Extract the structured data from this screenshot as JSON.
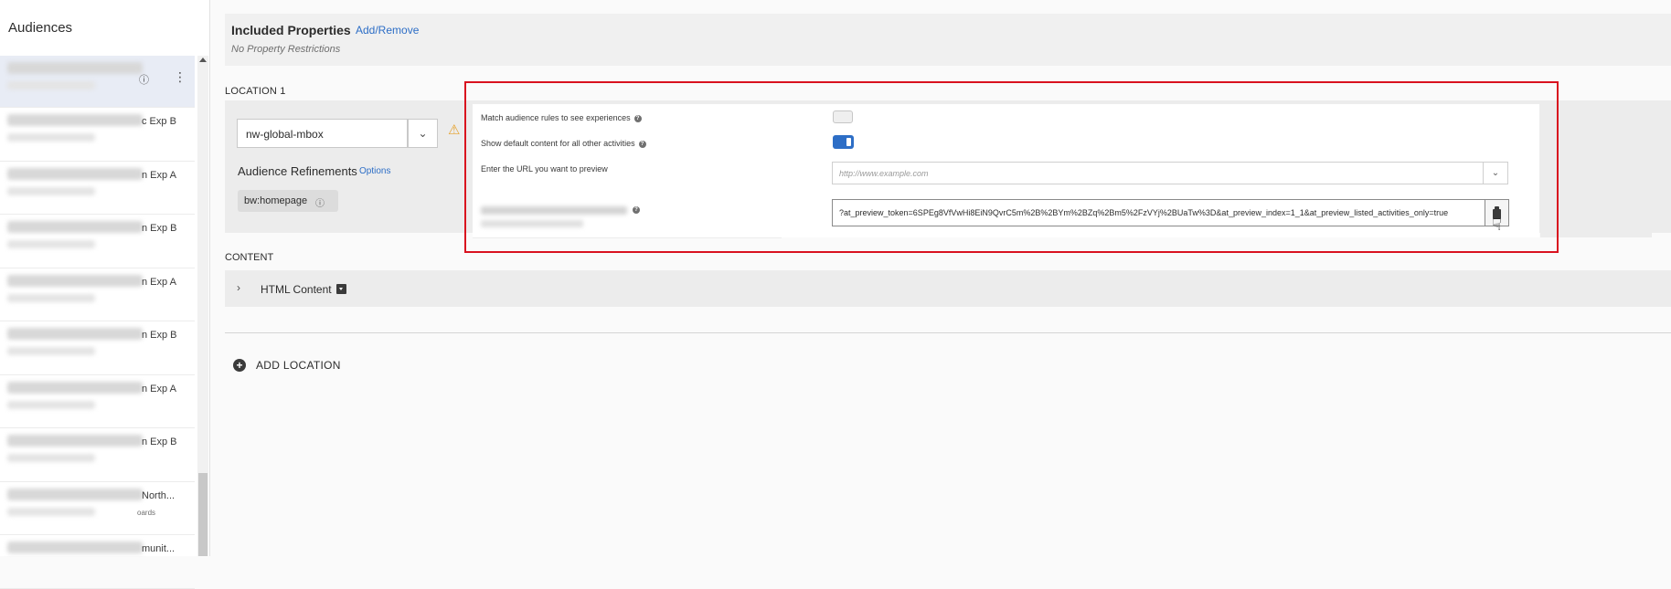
{
  "sidebar": {
    "title": "Audiences",
    "items": [
      {
        "suffix": "",
        "sub": ""
      },
      {
        "suffix": "c Exp B",
        "sub": ""
      },
      {
        "suffix": "n Exp A",
        "sub": ""
      },
      {
        "suffix": "n Exp B",
        "sub": ""
      },
      {
        "suffix": "n Exp A",
        "sub": ""
      },
      {
        "suffix": "n Exp B",
        "sub": ""
      },
      {
        "suffix": "n Exp A",
        "sub": ""
      },
      {
        "suffix": "n Exp B",
        "sub": ""
      },
      {
        "suffix": "North...",
        "sub": "oards"
      },
      {
        "suffix": "munit...",
        "sub": ""
      }
    ]
  },
  "properties": {
    "title": "Included Properties",
    "link": "Add/Remove",
    "subtitle": "No Property Restrictions"
  },
  "location": {
    "label": "LOCATION 1",
    "mbox": "nw-global-mbox",
    "refinements_label": "Audience Refinements",
    "options_link": "Options",
    "tag": "bw:homepage"
  },
  "content": {
    "label": "CONTENT",
    "html_label": "HTML Content"
  },
  "add_location": "ADD LOCATION",
  "preview": {
    "match_label": "Match audience rules to see experiences",
    "default_label": "Show default content for all other activities",
    "url_label": "Enter the URL you want to preview",
    "url_placeholder": "http://www.example.com",
    "token_value": "?at_preview_token=6SPEg8VfVwHi8EiN9QvrC5m%2B%2BYm%2BZq%2Bm5%2FzVYj%2BUaTw%3D&at_preview_index=1_1&at_preview_listed_activities_only=true",
    "match_toggle_on": false,
    "default_toggle_on": true
  },
  "colors": {
    "accent": "#2d6ec6",
    "highlight": "#d9121f",
    "warning": "#e6a12a"
  }
}
